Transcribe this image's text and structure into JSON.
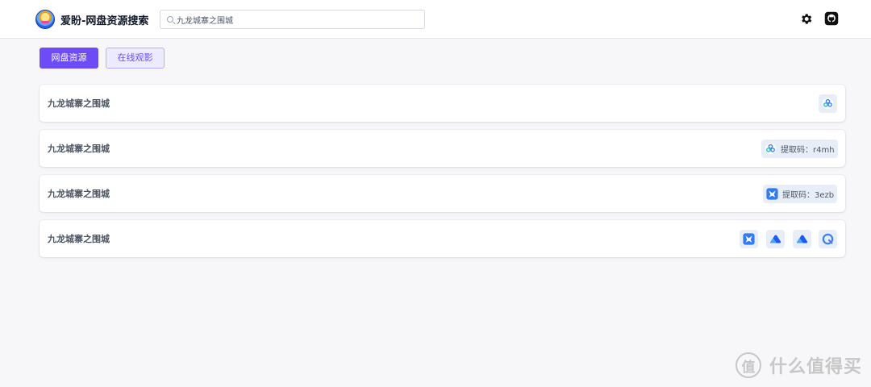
{
  "header": {
    "app_title": "爱盼-网盘资源搜索",
    "search": {
      "value": "九龙城寨之围城"
    }
  },
  "tabs": [
    {
      "label": "网盘资源",
      "active": true
    },
    {
      "label": "在线观影",
      "active": false
    }
  ],
  "results": [
    {
      "title": "九龙城寨之围城",
      "links": [
        {
          "icon": "baidu-pan-icon"
        }
      ]
    },
    {
      "title": "九龙城寨之围城",
      "links": [
        {
          "icon": "baidu-pan-icon",
          "text": "提取码：r4mh"
        }
      ]
    },
    {
      "title": "九龙城寨之围城",
      "links": [
        {
          "icon": "xunlei-icon",
          "text": "提取码：3ezb"
        }
      ]
    },
    {
      "title": "九龙城寨之围城",
      "links": [
        {
          "icon": "xunlei-icon"
        },
        {
          "icon": "aliyun-icon"
        },
        {
          "icon": "aliyun-icon"
        },
        {
          "icon": "quark-icon"
        }
      ]
    }
  ],
  "watermark": {
    "text": "什么值得买",
    "logo_char": "值"
  },
  "colors": {
    "accent": "#6d4cf7",
    "icon_blue": "#3b82f6",
    "badge_bg": "#e8eef8"
  }
}
